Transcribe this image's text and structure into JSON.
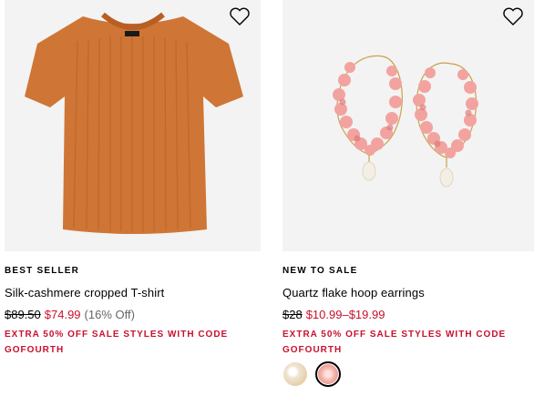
{
  "products": [
    {
      "badge": "BEST SELLER",
      "name": "Silk-cashmere cropped T-shirt",
      "original_price": "$89.50",
      "sale_price": "$74.99",
      "discount": "(16% Off)",
      "promo": "EXTRA 50% OFF SALE STYLES WITH CODE GOFOURTH",
      "image": "orange-ribbed-tshirt",
      "color": "#d27a3a",
      "wishlist_icon": "heart-outline-icon"
    },
    {
      "badge": "NEW TO SALE",
      "name": "Quartz flake hoop earrings",
      "original_price": "$28",
      "sale_price": "$10.99–$19.99",
      "promo": "EXTRA 50% OFF SALE STYLES WITH CODE GOFOURTH",
      "image": "pink-quartz-hoop-earrings",
      "color": "#f2a3a0",
      "wishlist_icon": "heart-outline-icon",
      "swatches": [
        {
          "name": "pearl-swatch",
          "color": "#efe6d6",
          "selected": false
        },
        {
          "name": "pink-quartz-swatch",
          "color": "#f4b7b0",
          "selected": true
        }
      ]
    }
  ],
  "colors": {
    "sale": "#c8102e",
    "image_bg": "#f3f3f3"
  }
}
